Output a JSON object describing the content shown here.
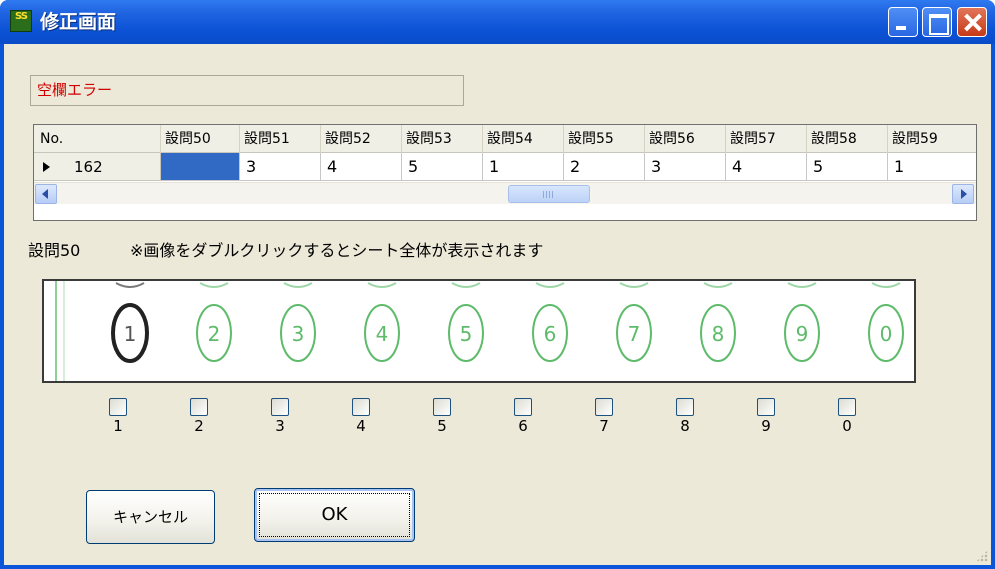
{
  "window": {
    "title": "修正画面",
    "icon": "app-icon",
    "icon_text": "SS",
    "buttons": [
      "minimize-icon",
      "maximize-icon",
      "close-icon"
    ]
  },
  "error_message": "空欄エラー",
  "grid": {
    "row_header_label": "No.",
    "columns": [
      "設問50",
      "設問51",
      "設問52",
      "設問53",
      "設問54",
      "設問55",
      "設問56",
      "設問57",
      "設問58",
      "設問59"
    ],
    "row": {
      "number": "162",
      "values": [
        "",
        "3",
        "4",
        "5",
        "1",
        "2",
        "3",
        "4",
        "5",
        "1"
      ],
      "selected_index": 0
    }
  },
  "question": {
    "label": "設問50",
    "note": "※画像をダブルクリックするとシート全体が表示されます"
  },
  "sheet_image": {
    "bubbles": [
      "1",
      "2",
      "3",
      "4",
      "5",
      "6",
      "7",
      "8",
      "9",
      "0"
    ],
    "marked": "1",
    "bubble_color": "#5dbb6a",
    "mark_color": "#222222"
  },
  "checkboxes": [
    "1",
    "2",
    "3",
    "4",
    "5",
    "6",
    "7",
    "8",
    "9",
    "0"
  ],
  "buttons": {
    "cancel": "キャンセル",
    "ok": "OK"
  },
  "colors": {
    "titlebar": "#0a55d8",
    "error_text": "#d00000",
    "selection": "#316ac5",
    "dialog_bg": "#ece9d8"
  }
}
